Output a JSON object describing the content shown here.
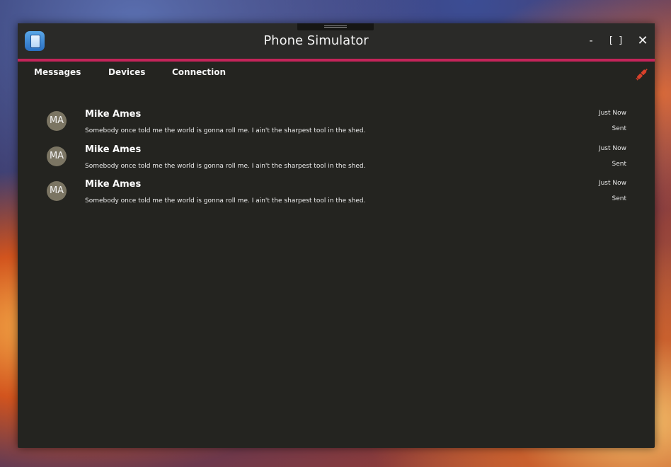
{
  "window": {
    "title": "Phone Simulator",
    "controls": {
      "minimize": "-",
      "maximize": "[ ]",
      "close": "✕"
    },
    "accent_color": "#c4245a"
  },
  "tabs": [
    {
      "label": "Messages"
    },
    {
      "label": "Devices"
    },
    {
      "label": "Connection"
    }
  ],
  "status_icon": "plug-icon",
  "messages": [
    {
      "initials": "MA",
      "sender": "Mike Ames",
      "body": "Somebody once told me the world is gonna roll me. I ain't the sharpest tool in the shed.",
      "time": "Just Now",
      "status": "Sent"
    },
    {
      "initials": "MA",
      "sender": "Mike Ames",
      "body": "Somebody once told me the world is gonna roll me. I ain't the sharpest tool in the shed.",
      "time": "Just Now",
      "status": "Sent"
    },
    {
      "initials": "MA",
      "sender": "Mike Ames",
      "body": "Somebody once told me the world is gonna roll me. I ain't the sharpest tool in the shed.",
      "time": "Just Now",
      "status": "Sent"
    }
  ]
}
